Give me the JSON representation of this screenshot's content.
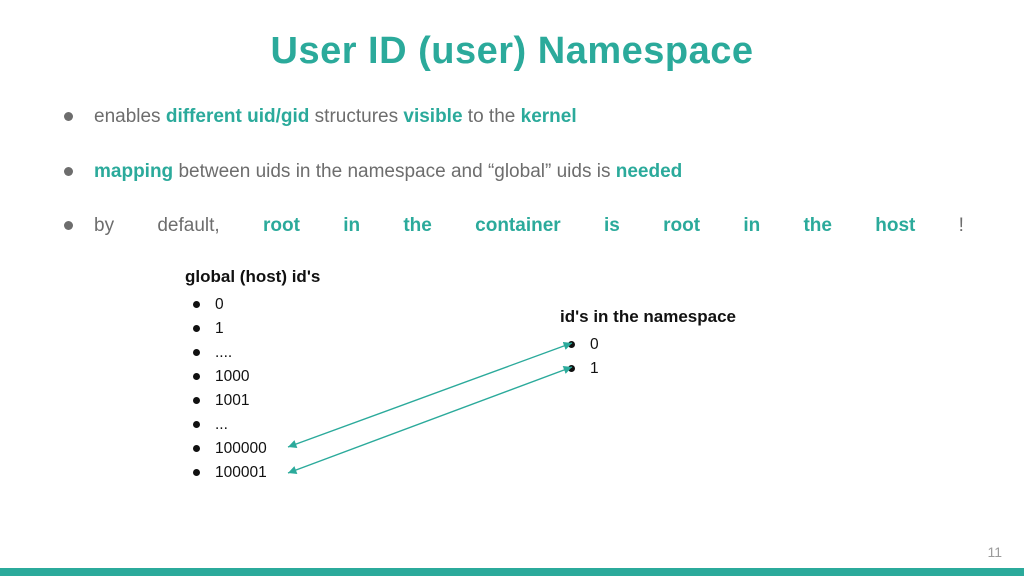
{
  "title": "User ID (user) Namespace",
  "bullet1": {
    "a": "enables ",
    "b": "different uid/gid",
    "c": " structures ",
    "d": "visible",
    "e": " to the ",
    "f": "kernel"
  },
  "bullet2": {
    "a": "mapping",
    "b": " between uids in the namespace and “global” uids is ",
    "c": "needed"
  },
  "bullet3": {
    "a": "by",
    "b": "default,",
    "c": "root",
    "d": "in",
    "e": "the",
    "f": "container",
    "g": "is",
    "h": "root",
    "i": "in",
    "j": "the",
    "k": "host",
    "l": "!"
  },
  "left": {
    "head": "global (host) id's",
    "items": [
      "0",
      "1",
      "....",
      "1000",
      "1001",
      "...",
      "100000",
      "100001"
    ]
  },
  "right": {
    "head": "id's in the namespace",
    "items": [
      "0",
      "1"
    ]
  },
  "colors": {
    "accent": "#2baa9b"
  },
  "page": "11"
}
